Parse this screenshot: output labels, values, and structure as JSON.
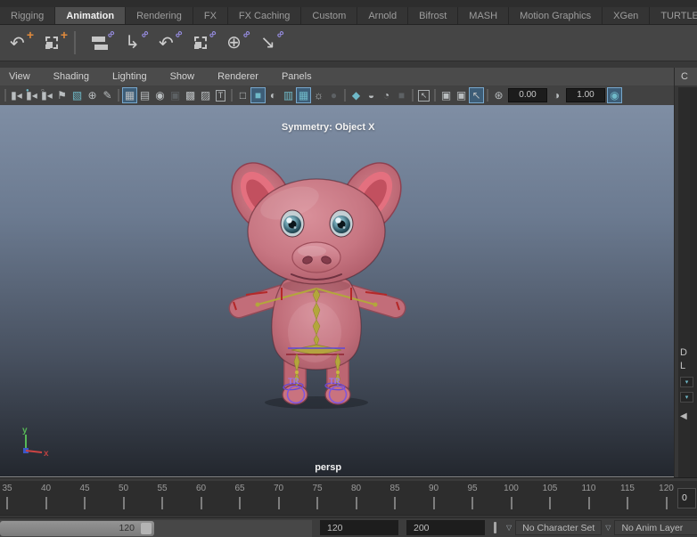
{
  "menuset_tabs": {
    "items": [
      {
        "label": "Rigging",
        "name": "tab-rigging",
        "active": false
      },
      {
        "label": "Animation",
        "name": "tab-animation",
        "active": true
      },
      {
        "label": "Rendering",
        "name": "tab-rendering",
        "active": false
      },
      {
        "label": "FX",
        "name": "tab-fx",
        "active": false
      },
      {
        "label": "FX Caching",
        "name": "tab-fx-caching",
        "active": false
      },
      {
        "label": "Custom",
        "name": "tab-custom",
        "active": false
      },
      {
        "label": "Arnold",
        "name": "tab-arnold",
        "active": false
      },
      {
        "label": "Bifrost",
        "name": "tab-bifrost",
        "active": false
      },
      {
        "label": "MASH",
        "name": "tab-mash",
        "active": false
      },
      {
        "label": "Motion Graphics",
        "name": "tab-motion-graphics",
        "active": false
      },
      {
        "label": "XGen",
        "name": "tab-xgen",
        "active": false
      },
      {
        "label": "TURTLE",
        "name": "tab-turtle",
        "active": false
      }
    ]
  },
  "main_toolbar": {
    "icons": [
      {
        "name": "curved-arrow-tool-icon",
        "glyph": "↷",
        "kind": "flip",
        "badge": "+",
        "btype": "plus"
      },
      {
        "name": "box-marker-tool-icon",
        "kind": "dashbox",
        "badge": "+",
        "btype": "plus"
      },
      {
        "kind": "sep"
      },
      {
        "name": "parent-constraint-icon",
        "kind": "rects",
        "badge": "∞",
        "btype": "chain"
      },
      {
        "name": "point-constraint-icon",
        "glyph": "↳",
        "badge": "∞",
        "btype": "chain"
      },
      {
        "name": "orient-constraint-icon",
        "glyph": "↷",
        "kind": "flip",
        "badge": "∞",
        "btype": "chain"
      },
      {
        "name": "scale-constraint-icon",
        "kind": "dashbox",
        "badge": "∞",
        "btype": "chain"
      },
      {
        "name": "aim-constraint-icon",
        "glyph": "⊕",
        "badge": "∞",
        "btype": "chain"
      },
      {
        "name": "pole-vector-constraint-icon",
        "glyph": "↘",
        "badge": "∞",
        "btype": "chain"
      }
    ]
  },
  "panel_menubar": {
    "items": [
      {
        "label": "View",
        "name": "menu-view"
      },
      {
        "label": "Shading",
        "name": "menu-shading"
      },
      {
        "label": "Lighting",
        "name": "menu-lighting"
      },
      {
        "label": "Show",
        "name": "menu-show"
      },
      {
        "label": "Renderer",
        "name": "menu-renderer"
      },
      {
        "label": "Panels",
        "name": "menu-panels"
      }
    ]
  },
  "panel_toolbar": {
    "icons": [
      {
        "kind": "sep"
      },
      {
        "name": "camera-select-icon",
        "glyph": "▮◂"
      },
      {
        "name": "camera-lock-icon",
        "glyph": "▮◂",
        "mark": "●",
        "mark_tint": "teal"
      },
      {
        "name": "camera-attributes-icon",
        "glyph": "▮◂",
        "mark": "○"
      },
      {
        "name": "bookmark-icon",
        "glyph": "⚑"
      },
      {
        "name": "image-plane-icon",
        "glyph": "▧",
        "tint": "teal"
      },
      {
        "name": "pan-zoom-icon",
        "glyph": "⊕"
      },
      {
        "name": "grease-pencil-icon",
        "glyph": "✎"
      },
      {
        "kind": "sep"
      },
      {
        "name": "grid-icon",
        "glyph": "▦",
        "kind": "hl"
      },
      {
        "name": "film-gate-icon",
        "glyph": "▤"
      },
      {
        "name": "resolution-gate-icon",
        "glyph": "◉"
      },
      {
        "name": "gate-mask-icon",
        "glyph": "▣",
        "kind": "dim"
      },
      {
        "name": "field-chart-icon",
        "glyph": "▩"
      },
      {
        "name": "safe-action-icon",
        "glyph": "▨"
      },
      {
        "name": "safe-title-icon",
        "glyph": "T",
        "kind": "boxed"
      },
      {
        "kind": "sep"
      },
      {
        "name": "wireframe-icon",
        "glyph": "□"
      },
      {
        "name": "smooth-shade-icon",
        "glyph": "■",
        "kind": "hl",
        "tint": "teal"
      },
      {
        "name": "default-material-icon",
        "glyph": "◐"
      },
      {
        "name": "textured-icon",
        "glyph": "▥",
        "tint": "teal"
      },
      {
        "name": "wireframe-on-shaded-icon",
        "glyph": "▦",
        "kind": "hl",
        "tint": "teal"
      },
      {
        "name": "lighting-icon",
        "glyph": "☼"
      },
      {
        "name": "flat-lighting-icon",
        "glyph": "●",
        "kind": "dim"
      },
      {
        "kind": "sep"
      },
      {
        "name": "shadows-icon",
        "glyph": "◆",
        "tint": "teal"
      },
      {
        "name": "occlusion-icon",
        "glyph": "◒"
      },
      {
        "name": "motion-blur-icon",
        "glyph": "◔"
      },
      {
        "name": "unused-toggle-icon",
        "glyph": "■",
        "kind": "dim"
      },
      {
        "kind": "sep"
      },
      {
        "name": "selection-highlight-icon",
        "glyph": "↖",
        "kind": "boxed"
      },
      {
        "kind": "sep"
      },
      {
        "name": "snapshot-icon",
        "glyph": "▣"
      },
      {
        "name": "snapshot-multi-icon",
        "glyph": "▣"
      },
      {
        "name": "isolate-select-icon",
        "glyph": "↖",
        "kind": "hl"
      },
      {
        "kind": "sep"
      },
      {
        "name": "exposure-icon",
        "glyph": "⊛"
      },
      {
        "name": "exposure-field",
        "glyph": "0.00",
        "kind": "field"
      },
      {
        "name": "gamma-icon",
        "glyph": "◑"
      },
      {
        "name": "gamma-field",
        "glyph": "1.00",
        "kind": "field"
      },
      {
        "name": "color-management-icon",
        "glyph": "◉",
        "kind": "hl",
        "tint": "teal"
      }
    ]
  },
  "viewport": {
    "symmetry_label": "Symmetry: Object X",
    "camera_label": "persp",
    "axis_x_label": "x",
    "axis_y_label": "y",
    "rig_labels": {
      "left_foot": "TR",
      "right_foot": "TR"
    }
  },
  "right_panel": {
    "channels_menu_partial": "C",
    "display_label": "D",
    "layers_label": "L",
    "option_arrow": "▾",
    "collapse_arrow": "◀"
  },
  "timeline": {
    "frames": [
      35,
      40,
      45,
      50,
      55,
      60,
      65,
      70,
      75,
      80,
      85,
      90,
      95,
      100,
      105,
      110,
      115,
      120
    ],
    "current_frame": "0"
  },
  "range_bar": {
    "range_end_label": "120",
    "playback_end": "120",
    "anim_end": "200",
    "dropdown_arrow": "▽",
    "character_set": "No Character Set",
    "anim_layer": "No Anim Layer"
  },
  "colors": {
    "viewport_top": "#7f8ea4",
    "viewport_bottom": "#23272e",
    "highlight_blue": "#3d5d77",
    "icon_teal": "#6fb9c8",
    "chain_purple": "#988ee4",
    "plus_orange": "#e08a3c",
    "pig_pink": "#c4707c",
    "rig_yellow": "#b3a63c",
    "rig_red": "#b42828",
    "ik_purple": "#8055dd"
  }
}
